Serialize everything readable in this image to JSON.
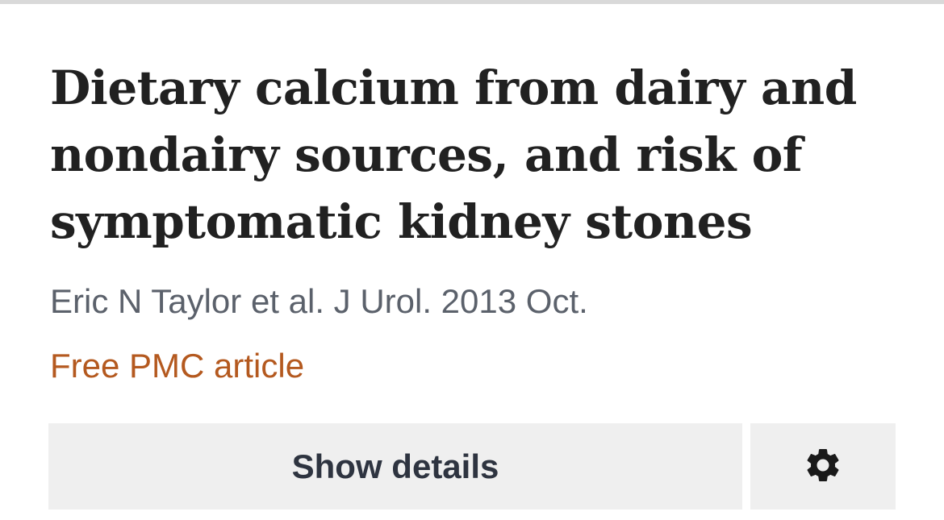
{
  "article": {
    "title_lines": [
      "Dietary calcium from dairy and",
      "nondairy sources, and risk of",
      "symptomatic kidney stones"
    ],
    "citation": "Eric N Taylor et al. J Urol. 2013 Oct.",
    "free_article_label": "Free PMC article"
  },
  "actions": {
    "details_label": "Show details",
    "settings_icon": "gear-icon"
  },
  "colors": {
    "title": "#212121",
    "citation": "#5b616b",
    "link": "#b4591f",
    "button_bg": "#efefef",
    "button_text": "#2e3440"
  }
}
